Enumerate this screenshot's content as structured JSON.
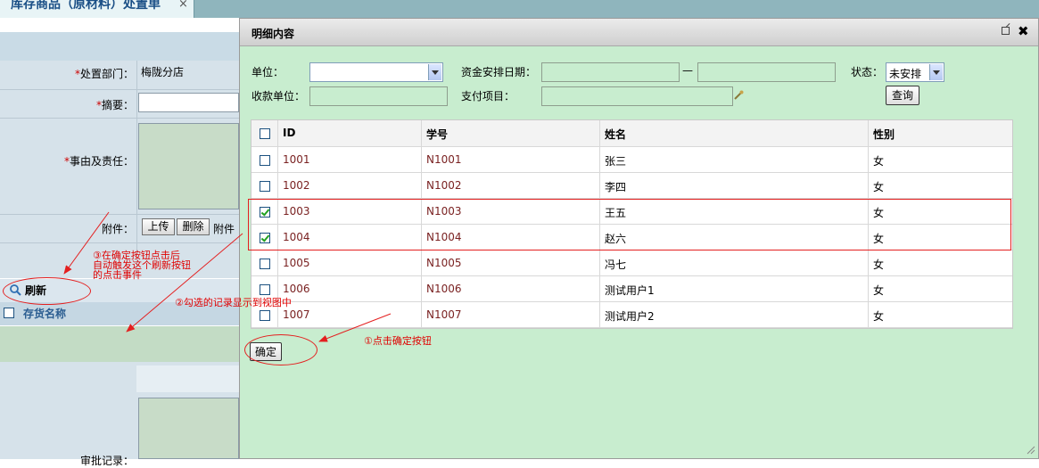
{
  "background": {
    "tab_title": "库存商品（原材料）处置单",
    "tab_close": "×",
    "form": {
      "dept_label": "处置部门：",
      "dept_value": "梅陇分店",
      "summary_label": "摘要：",
      "reason_label": "事由及责任：",
      "attach_label": "附件：",
      "upload_btn": "上传",
      "delete_btn": "删除",
      "attach_text": "附件"
    },
    "refresh_btn": "刷新",
    "list_col": "存货名称",
    "lower_label": "审批记录："
  },
  "dialog": {
    "title": "明细内容",
    "popout_icon": "popout-icon",
    "close_icon": "close-icon",
    "filters": {
      "unit_label": "单位：",
      "unit_value": "",
      "date_label": "资金安排日期：",
      "date_sep": "—",
      "status_label": "状态：",
      "status_value": "未安排",
      "payee_label": "收款单位：",
      "payitem_label": "支付项目：",
      "query_btn": "查询"
    },
    "grid": {
      "columns": [
        "ID",
        "学号",
        "姓名",
        "性别"
      ],
      "rows": [
        {
          "id": "1001",
          "no": "N1001",
          "name": "张三",
          "sex": "女",
          "checked": false
        },
        {
          "id": "1002",
          "no": "N1002",
          "name": "李四",
          "sex": "女",
          "checked": false
        },
        {
          "id": "1003",
          "no": "N1003",
          "name": "王五",
          "sex": "女",
          "checked": true
        },
        {
          "id": "1004",
          "no": "N1004",
          "name": "赵六",
          "sex": "女",
          "checked": true
        },
        {
          "id": "1005",
          "no": "N1005",
          "name": "冯七",
          "sex": "女",
          "checked": false
        },
        {
          "id": "1006",
          "no": "N1006",
          "name": "测试用户1",
          "sex": "女",
          "checked": false
        },
        {
          "id": "1007",
          "no": "N1007",
          "name": "测试用户2",
          "sex": "女",
          "checked": false
        }
      ]
    },
    "confirm_btn": "确定"
  },
  "annotations": {
    "step1": "①点击确定按钮",
    "step2": "②勾选的记录显示到视图中",
    "step3_line1": "③在确定按钮点击后",
    "step3_line2": "自动触发这个刷新按钮",
    "step3_line3": "的点击事件"
  },
  "colors": {
    "dialog_bg": "#c8edcf",
    "annotation": "#e41f1f",
    "tab_text": "#1a4f86"
  }
}
